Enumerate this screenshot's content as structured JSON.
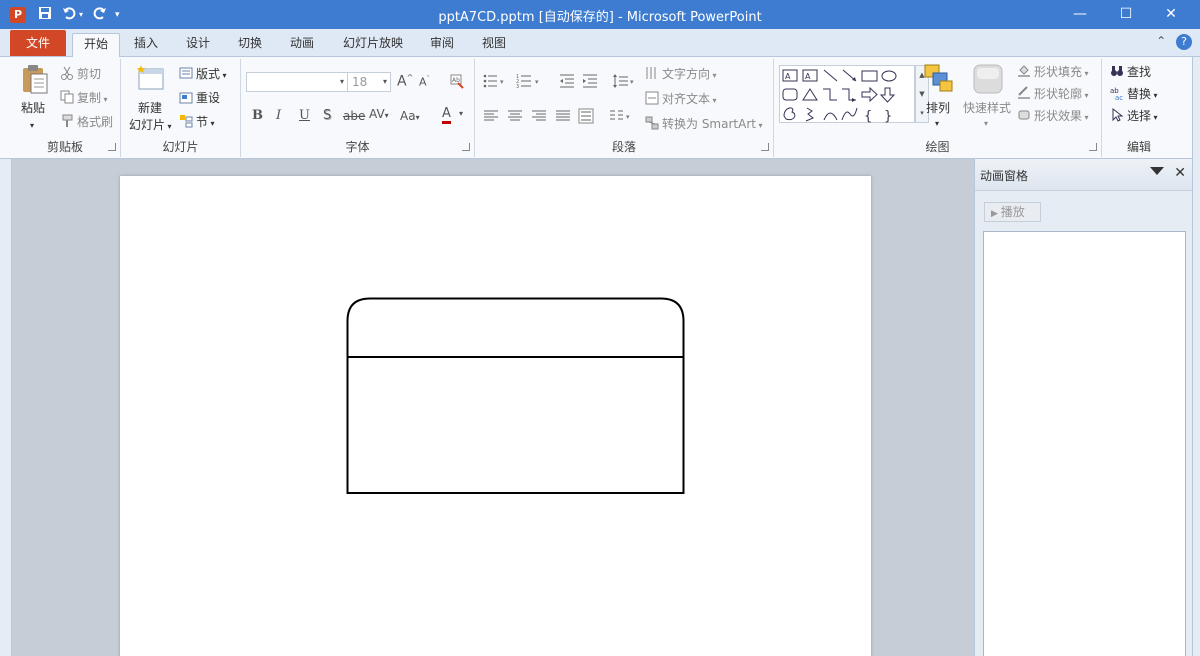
{
  "titlebar": {
    "title": "pptA7CD.pptm [自动保存的]  -  Microsoft PowerPoint",
    "app_icon_letter": "P",
    "minimize": "—",
    "maximize": "☐",
    "close": "✕"
  },
  "tabs": {
    "file": "文件",
    "items": [
      "开始",
      "插入",
      "设计",
      "切换",
      "动画",
      "幻灯片放映",
      "审阅",
      "视图"
    ],
    "active": "开始"
  },
  "ribbon": {
    "clipboard": {
      "label": "剪贴板",
      "paste": "粘贴",
      "cut": "剪切",
      "copy": "复制",
      "format_painter": "格式刷"
    },
    "slides": {
      "label": "幻灯片",
      "new_slide_line1": "新建",
      "new_slide_line2": "幻灯片",
      "layout": "版式",
      "reset": "重设",
      "section": "节"
    },
    "font": {
      "label": "字体",
      "font_name": "",
      "font_size": "18",
      "bold": "B",
      "italic": "I",
      "underline": "U",
      "shadow": "S",
      "strike": "abe",
      "spacing": "AV",
      "case": "Aa",
      "color": "A",
      "grow": "A",
      "shrink": "A"
    },
    "paragraph": {
      "label": "段落",
      "text_direction": "文字方向",
      "align_text": "对齐文本",
      "smartart": "转换为 SmartArt"
    },
    "drawing": {
      "label": "绘图",
      "arrange": "排列",
      "quick_styles": "快速样式",
      "shape_fill": "形状填充",
      "shape_outline": "形状轮廓",
      "shape_effects": "形状效果"
    },
    "editing": {
      "label": "编辑",
      "find": "查找",
      "replace": "替换",
      "select": "选择"
    }
  },
  "animation_pane": {
    "title": "动画窗格",
    "play": "播放"
  },
  "colors": {
    "titlebar": "#3d7cd0",
    "file_tab": "#d24726",
    "ribbon_bg": "#f7f9fc",
    "workspace": "#c6cdd6"
  }
}
